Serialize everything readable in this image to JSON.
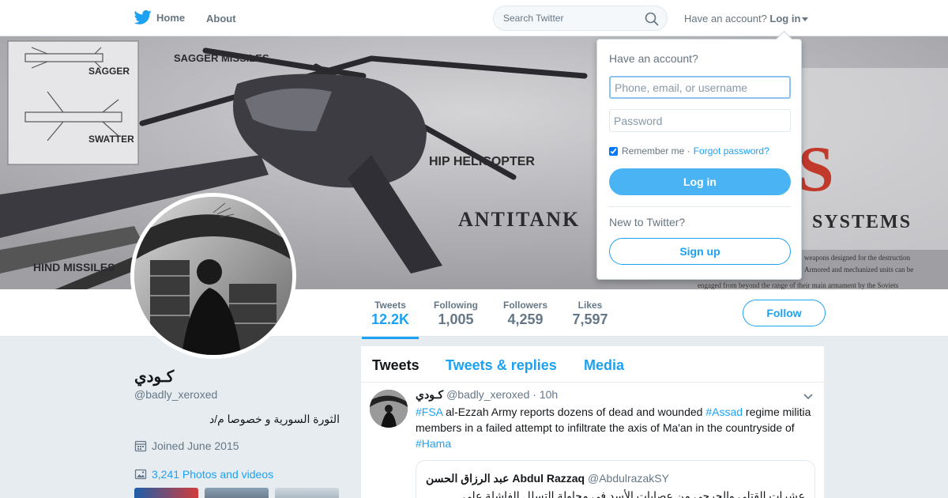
{
  "nav": {
    "home_label": "Home",
    "about_label": "About",
    "search_placeholder": "Search Twitter",
    "have_account": "Have an account?",
    "login_label": "Log in"
  },
  "banner": {
    "labels": [
      "SAGGER MISSILES",
      "SAGGER",
      "SWATTER",
      "HIP HELICOPTER",
      "ANTITANK",
      "SYSTEMS",
      "HIND MISSILES",
      "S"
    ],
    "fine_print": [
      "weapons designed for the destruction",
      "Armored and mechanized units can be",
      "engaged from beyond the range of their main armament by the Soviets"
    ]
  },
  "stats": [
    {
      "label": "Tweets",
      "value": "12.2K"
    },
    {
      "label": "Following",
      "value": "1,005"
    },
    {
      "label": "Followers",
      "value": "4,259"
    },
    {
      "label": "Likes",
      "value": "7,597"
    }
  ],
  "follow_label": "Follow",
  "profile": {
    "name": "كـودي",
    "handle": "@badly_xeroxed",
    "bio": "الثورة السورية و خصوصا م/د",
    "joined": "Joined June 2015",
    "media": "3,241 Photos and videos"
  },
  "timeline": {
    "tabs": [
      "Tweets",
      "Tweets & replies",
      "Media"
    ],
    "tweet": {
      "name": "كـودي",
      "handle": "@badly_xeroxed",
      "time": "· 10h",
      "tag1": "#FSA",
      "text1": " al-Ezzah Army reports dozens of dead and wounded ",
      "tag2": "#Assad",
      "text2": " regime militia members in a failed attempt to infiltrate the axis of Ma'an in the countryside of ",
      "tag3": "#Hama"
    },
    "quote": {
      "name": "عبد الرزاق الحسن Abdul Razzaq",
      "handle": "@AbdulrazakSY",
      "text": "عشرات القتلى والجرحى من عصابات الأسد في محاولة التسلل الفاشلة على"
    }
  },
  "login_popup": {
    "title": "Have an account?",
    "username_placeholder": "Phone, email, or username",
    "password_placeholder": "Password",
    "remember": "Remember me",
    "separator": "·",
    "forgot": "Forgot password?",
    "login_button": "Log in",
    "new_to": "New to Twitter?",
    "signup_button": "Sign up"
  },
  "colors": {
    "brand": "#1da1f2",
    "login_button": "#4ab3f4",
    "background": "#e6ecf0"
  },
  "icons": [
    "twitter-bird-icon",
    "search-icon",
    "calendar-icon",
    "image-icon",
    "chevron-down-icon"
  ]
}
